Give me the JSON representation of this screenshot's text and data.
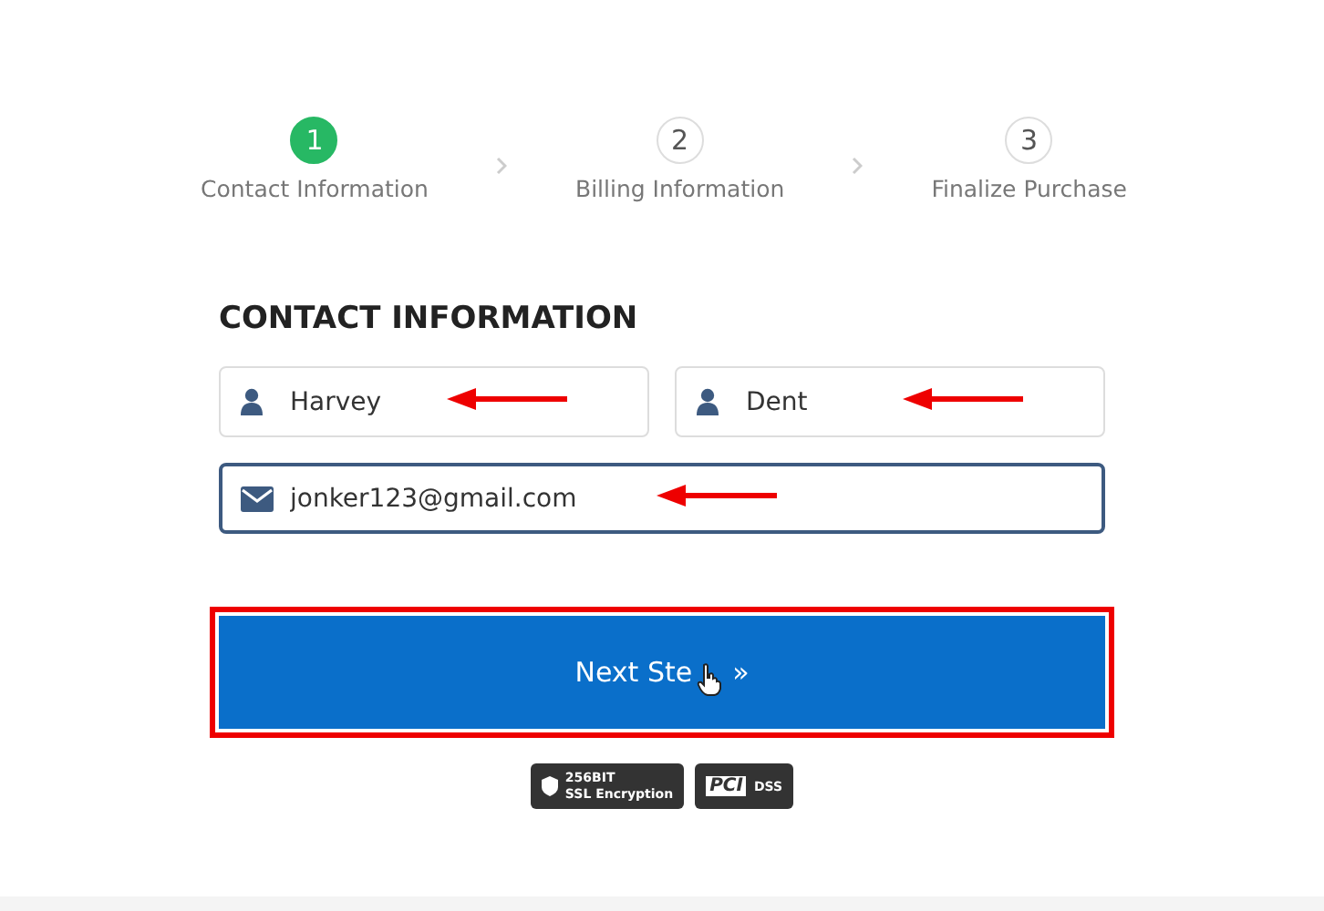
{
  "steps": [
    {
      "number": "1",
      "label": "Contact Information",
      "selected": true
    },
    {
      "number": "2",
      "label": "Billing Information",
      "selected": false
    },
    {
      "number": "3",
      "label": "Finalize Purchase",
      "selected": false
    }
  ],
  "section_title": "CONTACT INFORMATION",
  "fields": [
    {
      "kind": "person",
      "value": "Harvey",
      "focused": false,
      "annotated": true
    },
    {
      "kind": "person",
      "value": "Dent",
      "focused": false,
      "annotated": true
    },
    {
      "kind": "email",
      "value": "jonker123@gmail.com",
      "focused": true,
      "annotated": true
    }
  ],
  "next_button": {
    "label": "Next Ste",
    "arrow": "»",
    "highlighted": true
  },
  "badges": [
    {
      "kind": "ssl",
      "line_1": "256BIT",
      "line_2": "SSL Encryption"
    },
    {
      "kind": "pci",
      "line_1": "PCI",
      "line_2": "DSS"
    }
  ]
}
